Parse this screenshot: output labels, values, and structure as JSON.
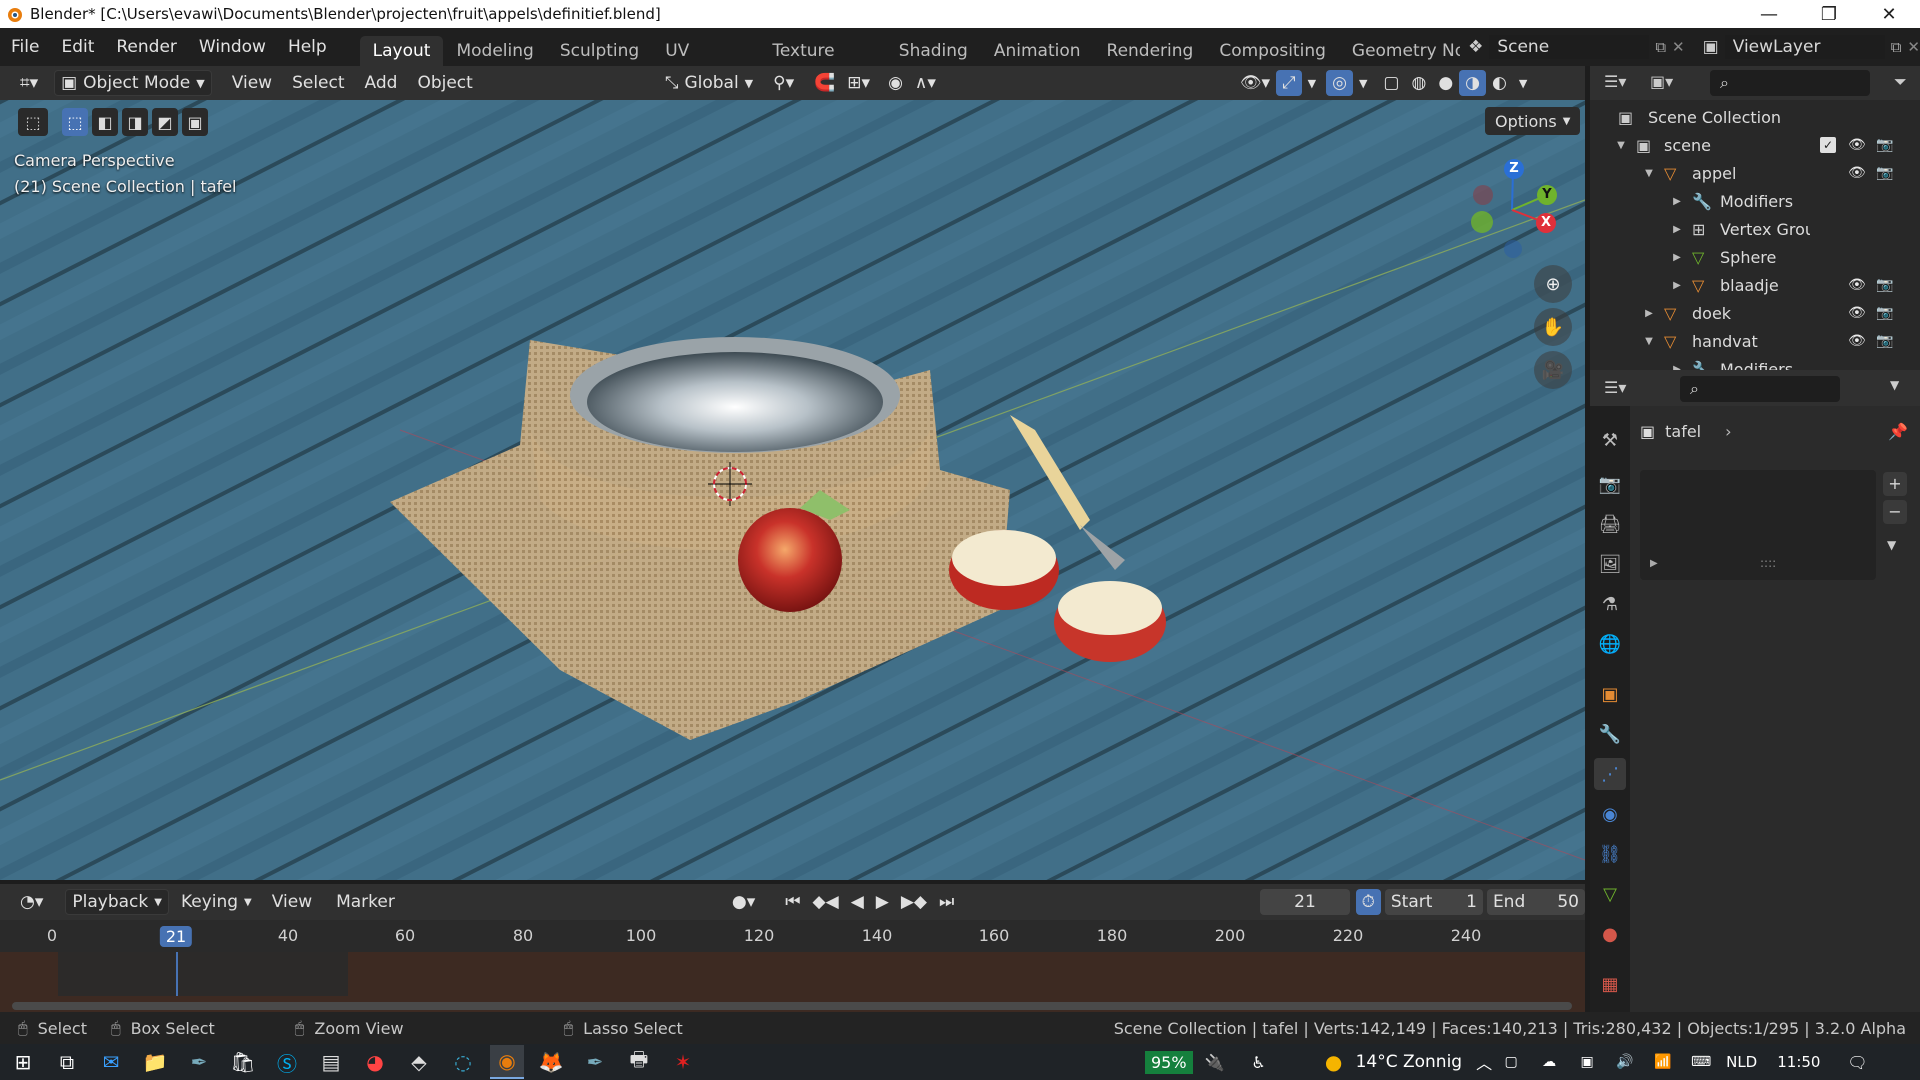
{
  "window": {
    "title": "Blender* [C:\\Users\\evawi\\Documents\\Blender\\projecten\\fruit\\appels\\definitief.blend]",
    "controls": [
      "—",
      "❐",
      "✕"
    ]
  },
  "menu": [
    "File",
    "Edit",
    "Render",
    "Window",
    "Help"
  ],
  "workspaces": [
    "Layout",
    "Modeling",
    "Sculpting",
    "UV Editing",
    "Texture Paint",
    "Shading",
    "Animation",
    "Rendering",
    "Compositing",
    "Geometry Node"
  ],
  "active_workspace": "Layout",
  "scene_name": "Scene",
  "view_layer": "ViewLayer",
  "viewport_header": {
    "mode": "Object Mode",
    "menus": [
      "View",
      "Select",
      "Add",
      "Object"
    ],
    "orientation": "Global",
    "options_label": "Options"
  },
  "viewport": {
    "line1": "Camera Perspective",
    "line2": "(21) Scene Collection | tafel",
    "gizmo": {
      "z": "Z",
      "y": "Y",
      "x": "X"
    }
  },
  "outliner": {
    "root": "Scene Collection",
    "rows": [
      {
        "label": "scene",
        "indent": 1
      },
      {
        "label": "appel",
        "indent": 2
      },
      {
        "label": "Modifiers",
        "indent": 3
      },
      {
        "label": "Vertex Grou",
        "indent": 3
      },
      {
        "label": "Sphere",
        "indent": 3
      },
      {
        "label": "blaadje",
        "indent": 3
      },
      {
        "label": "doek",
        "indent": 2
      },
      {
        "label": "handvat",
        "indent": 2
      },
      {
        "label": "Modifiers",
        "indent": 3
      }
    ]
  },
  "properties": {
    "object_name": "tafel",
    "dots": "::::"
  },
  "timeline": {
    "menus": [
      "Playback",
      "Keying",
      "View",
      "Marker"
    ],
    "current_frame": "21",
    "start_label": "Start",
    "start_value": "1",
    "end_label": "End",
    "end_value": "50",
    "ticks": [
      "0",
      "21",
      "40",
      "60",
      "80",
      "100",
      "120",
      "140",
      "160",
      "180",
      "200",
      "220",
      "240"
    ]
  },
  "statusbar": {
    "select": "Select",
    "box_select": "Box Select",
    "zoom_view": "Zoom View",
    "lasso_select": "Lasso Select",
    "stats": "Scene Collection | tafel | Verts:142,149 | Faces:140,213 | Tris:280,432 | Objects:1/295 | 3.2.0 Alpha"
  },
  "taskbar": {
    "battery": "95%",
    "weather": "14°C Zonnig",
    "language": "NLD",
    "time": "11:50"
  },
  "colors": {
    "accent": "#4772b3",
    "blender_orange": "#e48b33",
    "viewport_wood": "#3f6d86"
  }
}
